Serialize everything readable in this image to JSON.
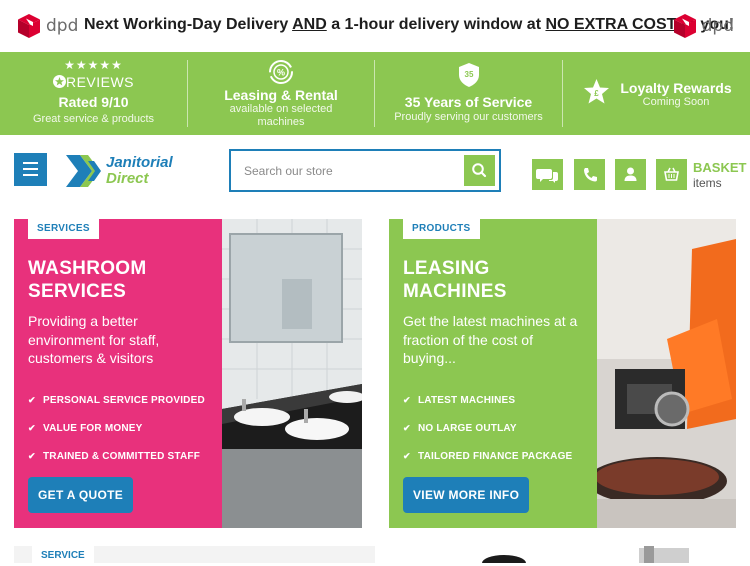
{
  "topbar": {
    "brand": "dpd",
    "message_parts": [
      "Next Working-Day Delivery ",
      "AND",
      " a 1-hour delivery window at ",
      "NO EXTRA COST",
      " to you!"
    ]
  },
  "features": {
    "reviews": {
      "stars": "★★★★★",
      "label": "REVIEWS",
      "rating": "Rated 9/10",
      "sub": "Great service & products"
    },
    "leasing": {
      "title": "Leasing & Rental",
      "sub": "available on selected machines"
    },
    "service": {
      "badge": "35",
      "title": "35 Years of Service",
      "sub": "Proudly serving our customers"
    },
    "loyalty": {
      "badge": "£",
      "title": "Loyalty Rewards",
      "sub": "Coming Soon"
    }
  },
  "header": {
    "logo_line1": "Janitorial",
    "logo_line2": "Direct",
    "search_placeholder": "Search our store",
    "basket_label": "BASKET",
    "basket_sub": "items"
  },
  "cards": [
    {
      "tag": "SERVICES",
      "title": "WASHROOM SERVICES",
      "desc": "Providing a better environment for staff, customers & visitors",
      "bullets": [
        "PERSONAL SERVICE PROVIDED",
        "VALUE FOR MONEY",
        "TRAINED & COMMITTED STAFF"
      ],
      "cta": "GET A QUOTE"
    },
    {
      "tag": "PRODUCTS",
      "title": "LEASING MACHINES",
      "desc": "Get the latest machines at a fraction of the cost of buying...",
      "bullets": [
        "LATEST MACHINES",
        "NO LARGE OUTLAY",
        "TAILORED FINANCE PACKAGE"
      ],
      "cta": "VIEW MORE INFO"
    }
  ],
  "bottom": {
    "tag": "SERVICE"
  },
  "colors": {
    "green": "#8cc751",
    "blue": "#1e7fb8",
    "pink": "#e8317c",
    "dpd_red": "#dc0032"
  }
}
